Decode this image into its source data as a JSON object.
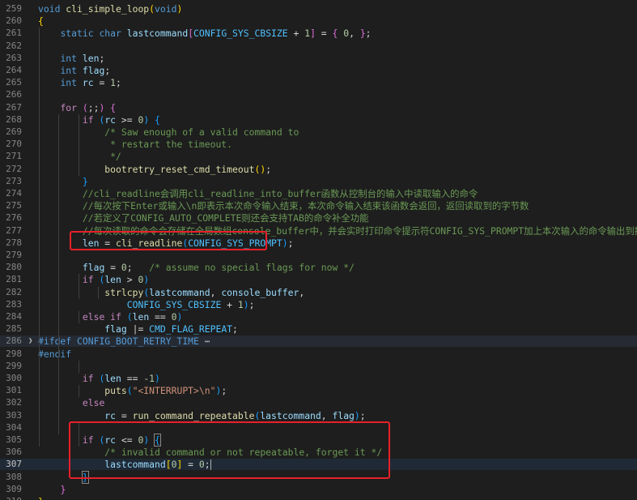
{
  "editor": {
    "lines": [
      {
        "num": "259",
        "tokens": [
          [
            "t-kw",
            "void"
          ],
          [
            "t-punct",
            " "
          ],
          [
            "t-fn",
            "cli_simple_loop"
          ],
          [
            "t-b1",
            "("
          ],
          [
            "t-kw",
            "void"
          ],
          [
            "t-b1",
            ")"
          ]
        ]
      },
      {
        "num": "260",
        "tokens": [
          [
            "t-b1",
            "{"
          ]
        ]
      },
      {
        "num": "261",
        "tokens": [
          [
            "t-punct",
            "    "
          ],
          [
            "t-kw",
            "static"
          ],
          [
            "t-punct",
            " "
          ],
          [
            "t-kw",
            "char"
          ],
          [
            "t-punct",
            " "
          ],
          [
            "t-var",
            "lastcommand"
          ],
          [
            "t-b2",
            "["
          ],
          [
            "t-mac",
            "CONFIG_SYS_CBSIZE"
          ],
          [
            "t-punct",
            " + "
          ],
          [
            "t-num",
            "1"
          ],
          [
            "t-b2",
            "]"
          ],
          [
            "t-punct",
            " = "
          ],
          [
            "t-b2",
            "{"
          ],
          [
            "t-punct",
            " "
          ],
          [
            "t-num",
            "0"
          ],
          [
            "t-punct",
            ", "
          ],
          [
            "t-b2",
            "}"
          ],
          [
            "t-punct",
            ";"
          ]
        ]
      },
      {
        "num": "262",
        "tokens": []
      },
      {
        "num": "263",
        "tokens": [
          [
            "t-punct",
            "    "
          ],
          [
            "t-kw",
            "int"
          ],
          [
            "t-punct",
            " "
          ],
          [
            "t-var",
            "len"
          ],
          [
            "t-punct",
            ";"
          ]
        ]
      },
      {
        "num": "264",
        "tokens": [
          [
            "t-punct",
            "    "
          ],
          [
            "t-kw",
            "int"
          ],
          [
            "t-punct",
            " "
          ],
          [
            "t-var",
            "flag"
          ],
          [
            "t-punct",
            ";"
          ]
        ]
      },
      {
        "num": "265",
        "tokens": [
          [
            "t-punct",
            "    "
          ],
          [
            "t-kw",
            "int"
          ],
          [
            "t-punct",
            " "
          ],
          [
            "t-var",
            "rc"
          ],
          [
            "t-punct",
            " = "
          ],
          [
            "t-num",
            "1"
          ],
          [
            "t-punct",
            ";"
          ]
        ]
      },
      {
        "num": "266",
        "tokens": []
      },
      {
        "num": "267",
        "tokens": [
          [
            "t-punct",
            "    "
          ],
          [
            "t-ctrl",
            "for"
          ],
          [
            "t-punct",
            " "
          ],
          [
            "t-b2",
            "("
          ],
          [
            "t-punct",
            ";;"
          ],
          [
            "t-b2",
            ")"
          ],
          [
            "t-punct",
            " "
          ],
          [
            "t-b2",
            "{"
          ]
        ]
      },
      {
        "num": "268",
        "tokens": [
          [
            "t-punct",
            "        "
          ],
          [
            "t-ctrl",
            "if"
          ],
          [
            "t-punct",
            " "
          ],
          [
            "t-b3",
            "("
          ],
          [
            "t-var",
            "rc"
          ],
          [
            "t-punct",
            " >= "
          ],
          [
            "t-num",
            "0"
          ],
          [
            "t-b3",
            ")"
          ],
          [
            "t-punct",
            " "
          ],
          [
            "t-b3",
            "{"
          ]
        ]
      },
      {
        "num": "269",
        "tokens": [
          [
            "t-punct",
            "            "
          ],
          [
            "t-com",
            "/* Saw enough of a valid command to"
          ]
        ]
      },
      {
        "num": "270",
        "tokens": [
          [
            "t-punct",
            "             "
          ],
          [
            "t-com",
            "* restart the timeout."
          ]
        ]
      },
      {
        "num": "271",
        "tokens": [
          [
            "t-punct",
            "             "
          ],
          [
            "t-com",
            "*/"
          ]
        ]
      },
      {
        "num": "272",
        "tokens": [
          [
            "t-punct",
            "            "
          ],
          [
            "t-fn",
            "bootretry_reset_cmd_timeout"
          ],
          [
            "t-b1",
            "()"
          ],
          [
            "t-punct",
            ";"
          ]
        ]
      },
      {
        "num": "273",
        "tokens": [
          [
            "t-punct",
            "        "
          ],
          [
            "t-b3",
            "}"
          ]
        ]
      },
      {
        "num": "274",
        "tokens": [
          [
            "t-punct",
            "        "
          ],
          [
            "t-com",
            "//cli_readline会调用cli_readline_into_buffer函数从控制台的输入中读取输入的命令"
          ]
        ]
      },
      {
        "num": "275",
        "tokens": [
          [
            "t-punct",
            "        "
          ],
          [
            "t-com",
            "//每次按下Enter或输入\\n即表示本次命令输入结束，本次命令输入结束该函数会返回，返回读取到的字节数"
          ]
        ]
      },
      {
        "num": "276",
        "tokens": [
          [
            "t-punct",
            "        "
          ],
          [
            "t-com",
            "//若定义了CONFIG_AUTO_COMPLETE则还会支持TAB的命令补全功能"
          ]
        ]
      },
      {
        "num": "277",
        "tokens": [
          [
            "t-punct",
            "        "
          ],
          [
            "t-com",
            "//每次读取的命令会存储在全局数组console_buffer中，并会实时打印命令提示符CONFIG_SYS_PROMPT加上本次输入的命令输出到控制台"
          ]
        ]
      },
      {
        "num": "278",
        "tokens": [
          [
            "t-punct",
            "        "
          ],
          [
            "t-var",
            "len"
          ],
          [
            "t-punct",
            " = "
          ],
          [
            "t-fn",
            "cli_readline"
          ],
          [
            "t-b3",
            "("
          ],
          [
            "t-mac",
            "CONFIG_SYS_PROMPT"
          ],
          [
            "t-b3",
            ")"
          ],
          [
            "t-punct",
            ";"
          ]
        ]
      },
      {
        "num": "279",
        "tokens": []
      },
      {
        "num": "280",
        "tokens": [
          [
            "t-punct",
            "        "
          ],
          [
            "t-var",
            "flag"
          ],
          [
            "t-punct",
            " = "
          ],
          [
            "t-num",
            "0"
          ],
          [
            "t-punct",
            ";   "
          ],
          [
            "t-com",
            "/* assume no special flags for now */"
          ]
        ]
      },
      {
        "num": "281",
        "tokens": [
          [
            "t-punct",
            "        "
          ],
          [
            "t-ctrl",
            "if"
          ],
          [
            "t-punct",
            " "
          ],
          [
            "t-b3",
            "("
          ],
          [
            "t-var",
            "len"
          ],
          [
            "t-punct",
            " > "
          ],
          [
            "t-num",
            "0"
          ],
          [
            "t-b3",
            ")"
          ]
        ]
      },
      {
        "num": "282",
        "tokens": [
          [
            "t-punct",
            "            "
          ],
          [
            "t-fn",
            "strlcpy"
          ],
          [
            "t-b3",
            "("
          ],
          [
            "t-var",
            "lastcommand"
          ],
          [
            "t-punct",
            ", "
          ],
          [
            "t-var",
            "console_buffer"
          ],
          [
            "t-punct",
            ","
          ]
        ]
      },
      {
        "num": "283",
        "tokens": [
          [
            "t-punct",
            "                "
          ],
          [
            "t-mac",
            "CONFIG_SYS_CBSIZE"
          ],
          [
            "t-punct",
            " + "
          ],
          [
            "t-num",
            "1"
          ],
          [
            "t-b3",
            ")"
          ],
          [
            "t-punct",
            ";"
          ]
        ]
      },
      {
        "num": "284",
        "tokens": [
          [
            "t-punct",
            "        "
          ],
          [
            "t-ctrl",
            "else"
          ],
          [
            "t-punct",
            " "
          ],
          [
            "t-ctrl",
            "if"
          ],
          [
            "t-punct",
            " "
          ],
          [
            "t-b3",
            "("
          ],
          [
            "t-var",
            "len"
          ],
          [
            "t-punct",
            " == "
          ],
          [
            "t-num",
            "0"
          ],
          [
            "t-b3",
            ")"
          ]
        ]
      },
      {
        "num": "285",
        "tokens": [
          [
            "t-punct",
            "            "
          ],
          [
            "t-var",
            "flag"
          ],
          [
            "t-punct",
            " |= "
          ],
          [
            "t-mac",
            "CMD_FLAG_REPEAT"
          ],
          [
            "t-punct",
            ";"
          ]
        ]
      },
      {
        "num": "286",
        "fold": true,
        "tokens": [
          [
            "t-pp",
            "#ifdef"
          ],
          [
            "t-punct",
            " "
          ],
          [
            "t-ppdef",
            "CONFIG_BOOT_RETRY_TIME"
          ],
          [
            "t-ellip",
            " ⋯"
          ]
        ]
      },
      {
        "num": "298",
        "tokens": [
          [
            "t-pp",
            "#endif"
          ]
        ]
      },
      {
        "num": "299",
        "tokens": []
      },
      {
        "num": "300",
        "tokens": [
          [
            "t-punct",
            "        "
          ],
          [
            "t-ctrl",
            "if"
          ],
          [
            "t-punct",
            " "
          ],
          [
            "t-b3",
            "("
          ],
          [
            "t-var",
            "len"
          ],
          [
            "t-punct",
            " == "
          ],
          [
            "t-num",
            "-1"
          ],
          [
            "t-b3",
            ")"
          ]
        ]
      },
      {
        "num": "301",
        "tokens": [
          [
            "t-punct",
            "            "
          ],
          [
            "t-fn",
            "puts"
          ],
          [
            "t-b3",
            "("
          ],
          [
            "t-str",
            "\"<INTERRUPT>\\n\""
          ],
          [
            "t-b3",
            ")"
          ],
          [
            "t-punct",
            ";"
          ]
        ]
      },
      {
        "num": "302",
        "tokens": [
          [
            "t-punct",
            "        "
          ],
          [
            "t-ctrl",
            "else"
          ]
        ]
      },
      {
        "num": "303",
        "tokens": [
          [
            "t-punct",
            "            "
          ],
          [
            "t-var",
            "rc"
          ],
          [
            "t-punct",
            " = "
          ],
          [
            "t-fn",
            "run_command_repeatable"
          ],
          [
            "t-b3",
            "("
          ],
          [
            "t-var",
            "lastcommand"
          ],
          [
            "t-punct",
            ", "
          ],
          [
            "t-var",
            "flag"
          ],
          [
            "t-b3",
            ")"
          ],
          [
            "t-punct",
            ";"
          ]
        ]
      },
      {
        "num": "304",
        "tokens": []
      },
      {
        "num": "305",
        "tokens": [
          [
            "t-punct",
            "        "
          ],
          [
            "t-ctrl",
            "if"
          ],
          [
            "t-punct",
            " "
          ],
          [
            "t-b3",
            "("
          ],
          [
            "t-var",
            "rc"
          ],
          [
            "t-punct",
            " <= "
          ],
          [
            "t-num",
            "0"
          ],
          [
            "t-b3",
            ")"
          ],
          [
            "t-punct",
            " "
          ],
          [
            "t-b3 bracket-box",
            "{"
          ]
        ]
      },
      {
        "num": "306",
        "tokens": [
          [
            "t-punct",
            "            "
          ],
          [
            "t-com",
            "/* invalid command or not repeatable, forget it */"
          ]
        ]
      },
      {
        "num": "307",
        "current": true,
        "cursor": true,
        "tokens": [
          [
            "t-punct",
            "            "
          ],
          [
            "t-var",
            "lastcommand"
          ],
          [
            "t-b1",
            "["
          ],
          [
            "t-num",
            "0"
          ],
          [
            "t-b1",
            "]"
          ],
          [
            "t-punct",
            " = "
          ],
          [
            "t-num",
            "0"
          ],
          [
            "t-punct",
            ";"
          ]
        ]
      },
      {
        "num": "308",
        "tokens": [
          [
            "t-punct",
            "        "
          ],
          [
            "t-b3 bracket-box",
            "}"
          ]
        ]
      },
      {
        "num": "309",
        "tokens": [
          [
            "t-punct",
            "    "
          ],
          [
            "t-b2",
            "}"
          ]
        ]
      },
      {
        "num": "310",
        "tokens": [
          [
            "t-b1",
            "}"
          ]
        ]
      }
    ]
  }
}
